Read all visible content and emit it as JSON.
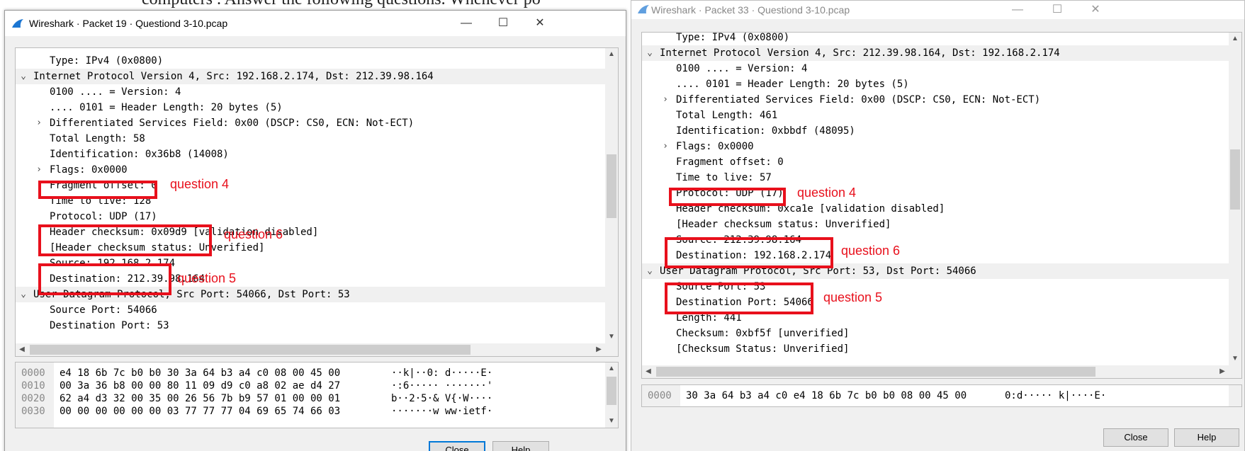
{
  "document": {
    "bg_text": "computers . Answer the following questions. Whenever po"
  },
  "colors": {
    "highlight": "#e8101c",
    "wireshark_fin": "#1c76d2",
    "selected_row": "#f0f0f0"
  },
  "left_window": {
    "title": "Wireshark · Packet 19 · Questiond 3-10.pcap",
    "controls": {
      "minimize": "—",
      "maximize": "☐",
      "close": "✕"
    },
    "tree_rows": [
      {
        "arrow": "",
        "text": "Type: IPv4 (0x0800)"
      },
      {
        "arrow": "⌄",
        "text": "Internet Protocol Version 4, Src: 192.168.2.174, Dst: 212.39.98.164"
      },
      {
        "arrow": "",
        "text": "0100 .... = Version: 4"
      },
      {
        "arrow": "",
        "text": ".... 0101 = Header Length: 20 bytes (5)"
      },
      {
        "arrow": "›",
        "text": "Differentiated Services Field: 0x00 (DSCP: CS0, ECN: Not-ECT)"
      },
      {
        "arrow": "",
        "text": "Total Length: 58"
      },
      {
        "arrow": "",
        "text": "Identification: 0x36b8 (14008)"
      },
      {
        "arrow": "›",
        "text": "Flags: 0x0000"
      },
      {
        "arrow": "",
        "text": "Fragment offset: 0"
      },
      {
        "arrow": "",
        "text": "Time to live: 128"
      },
      {
        "arrow": "",
        "text": "Protocol: UDP (17)"
      },
      {
        "arrow": "",
        "text": "Header checksum: 0x09d9 [validation disabled]"
      },
      {
        "arrow": "",
        "text": "[Header checksum status: Unverified]"
      },
      {
        "arrow": "",
        "text": "Source: 192.168.2.174"
      },
      {
        "arrow": "",
        "text": "Destination: 212.39.98.164"
      },
      {
        "arrow": "⌄",
        "text": "User Datagram Protocol, Src Port: 54066, Dst Port: 53"
      },
      {
        "arrow": "",
        "text": "Source Port: 54066"
      },
      {
        "arrow": "",
        "text": "Destination Port: 53"
      }
    ],
    "hex_rows": [
      {
        "offset": "0000",
        "bytes": "e4 18 6b 7c b0 b0 30 3a  64 b3 a4 c0 08 00 45 00",
        "ascii": "··k|··0: d·····E·"
      },
      {
        "offset": "0010",
        "bytes": "00 3a 36 b8 00 00 80 11  09 d9 c0 a8 02 ae d4 27",
        "ascii": "·:6····· ·······'"
      },
      {
        "offset": "0020",
        "bytes": "62 a4 d3 32 00 35 00 26  56 7b b9 57 01 00 00 01",
        "ascii": "b··2·5·& V{·W····"
      },
      {
        "offset": "0030",
        "bytes": "00 00 00 00 00 00 03 77  77 77 04 69 65 74 66 03",
        "ascii": "·······w ww·ietf·"
      }
    ],
    "annotations": {
      "q4": "question 4",
      "q6": "question 6",
      "q5": "question 5"
    },
    "buttons": {
      "close": "Close",
      "help": "Help"
    }
  },
  "right_window": {
    "title": "Wireshark · Packet 33 · Questiond 3-10.pcap",
    "controls": {
      "minimize": "—",
      "maximize": "☐",
      "close": "✕"
    },
    "tree_rows": [
      {
        "arrow": "",
        "text": "Type: IPv4 (0x0800)"
      },
      {
        "arrow": "⌄",
        "text": "Internet Protocol Version 4, Src: 212.39.98.164, Dst: 192.168.2.174"
      },
      {
        "arrow": "",
        "text": "0100 .... = Version: 4"
      },
      {
        "arrow": "",
        "text": ".... 0101 = Header Length: 20 bytes (5)"
      },
      {
        "arrow": "›",
        "text": "Differentiated Services Field: 0x00 (DSCP: CS0, ECN: Not-ECT)"
      },
      {
        "arrow": "",
        "text": "Total Length: 461"
      },
      {
        "arrow": "",
        "text": "Identification: 0xbbdf (48095)"
      },
      {
        "arrow": "›",
        "text": "Flags: 0x0000"
      },
      {
        "arrow": "",
        "text": "Fragment offset: 0"
      },
      {
        "arrow": "",
        "text": "Time to live: 57"
      },
      {
        "arrow": "",
        "text": "Protocol: UDP (17)"
      },
      {
        "arrow": "",
        "text": "Header checksum: 0xca1e [validation disabled]"
      },
      {
        "arrow": "",
        "text": "[Header checksum status: Unverified]"
      },
      {
        "arrow": "",
        "text": "Source: 212.39.98.164"
      },
      {
        "arrow": "",
        "text": "Destination: 192.168.2.174"
      },
      {
        "arrow": "⌄",
        "text": "User Datagram Protocol, Src Port: 53, Dst Port: 54066"
      },
      {
        "arrow": "",
        "text": "Source Port: 53"
      },
      {
        "arrow": "",
        "text": "Destination Port: 54066"
      },
      {
        "arrow": "",
        "text": "Length: 441"
      },
      {
        "arrow": "",
        "text": "Checksum: 0xbf5f [unverified]"
      },
      {
        "arrow": "",
        "text": "[Checksum Status: Unverified]"
      }
    ],
    "hex_rows": [
      {
        "offset": "0000",
        "bytes": "30 3a 64 b3 a4 c0 e4 18  6b 7c b0 b0 08 00 45 00",
        "ascii": "0:d····· k|····E·"
      }
    ],
    "annotations": {
      "q4": "question 4",
      "q6": "question 6",
      "q5": "question 5"
    },
    "buttons": {
      "close": "Close",
      "help": "Help"
    }
  }
}
